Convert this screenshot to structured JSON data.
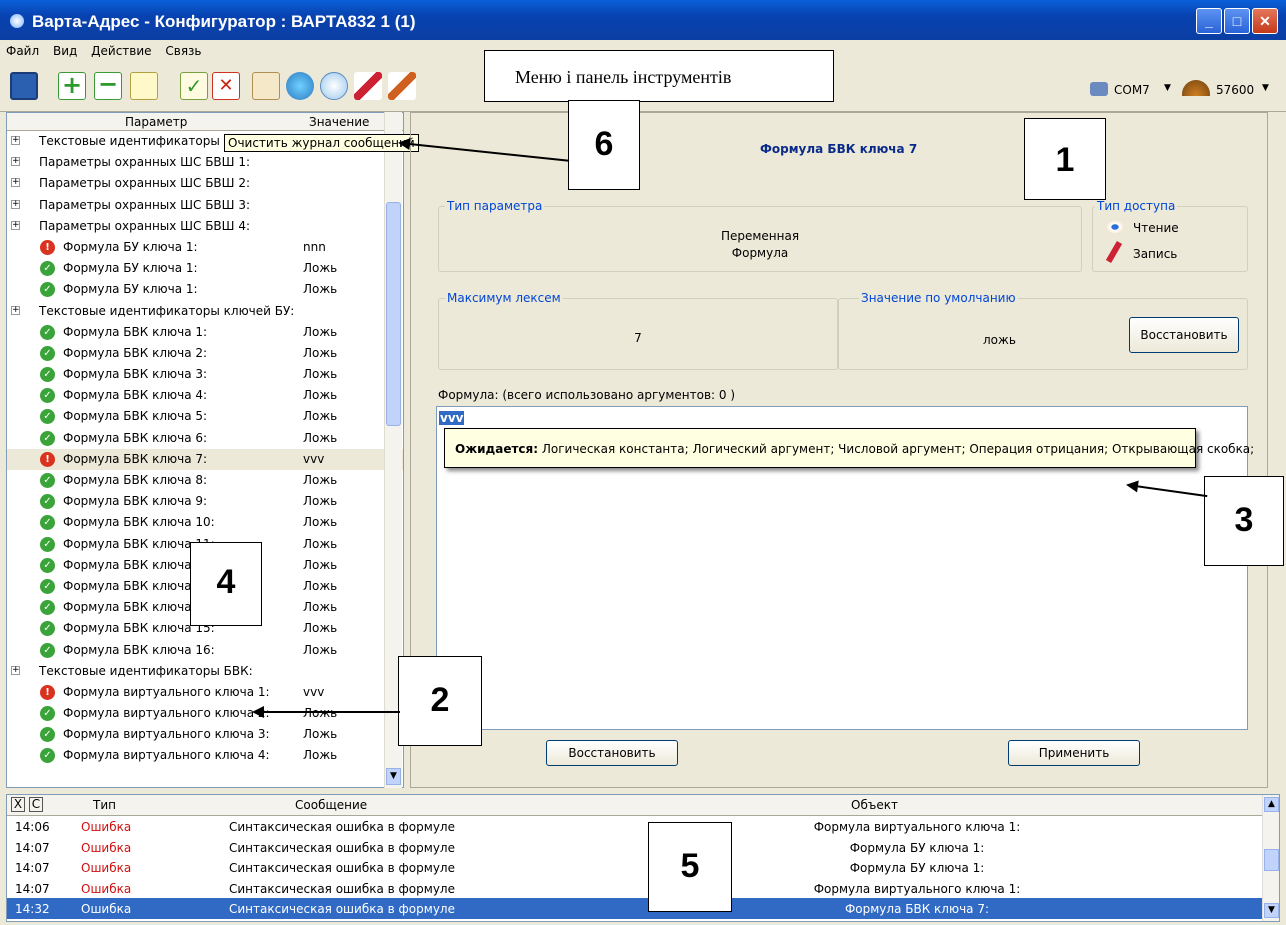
{
  "window": {
    "title": "Варта-Адрес - Конфигуратор : ВАРТА832 1 (1)",
    "min_icon": "minimize-icon",
    "max_icon": "maximize-icon",
    "close_icon": "close-icon"
  },
  "menu": [
    "Файл",
    "Вид",
    "Действие",
    "Связь"
  ],
  "toolbar": {
    "port": "COM7",
    "baud": "57600"
  },
  "callouts": {
    "menu_label": "Меню і панель інструментів",
    "c1": "1",
    "c2": "2",
    "c3": "3",
    "c4": "4",
    "c5": "5",
    "c6": "6"
  },
  "tree": {
    "col_param": "Параметр",
    "col_value": "Значение",
    "tooltip": "Очистить журнал сообщений",
    "rows": [
      {
        "type": "group",
        "label": "Текстовые идентификаторы Ш",
        "value": ""
      },
      {
        "type": "group",
        "label": "Параметры охранных ШС БВШ 1:",
        "value": ""
      },
      {
        "type": "group",
        "label": "Параметры охранных ШС БВШ 2:",
        "value": ""
      },
      {
        "type": "group",
        "label": "Параметры охранных ШС БВШ 3:",
        "value": ""
      },
      {
        "type": "group",
        "label": "Параметры охранных ШС БВШ 4:",
        "value": ""
      },
      {
        "type": "err",
        "label": "Формула БУ ключа 1:",
        "value": "nnn"
      },
      {
        "type": "ok",
        "label": "Формула БУ ключа 1:",
        "value": "Ложь"
      },
      {
        "type": "ok",
        "label": "Формула БУ ключа 1:",
        "value": "Ложь"
      },
      {
        "type": "group",
        "label": "Текстовые идентификаторы ключей БУ:",
        "value": ""
      },
      {
        "type": "ok",
        "label": "Формула БВК ключа 1:",
        "value": "Ложь"
      },
      {
        "type": "ok",
        "label": "Формула БВК ключа 2:",
        "value": "Ложь"
      },
      {
        "type": "ok",
        "label": "Формула БВК ключа 3:",
        "value": "Ложь"
      },
      {
        "type": "ok",
        "label": "Формула БВК ключа 4:",
        "value": "Ложь"
      },
      {
        "type": "ok",
        "label": "Формула БВК ключа 5:",
        "value": "Ложь"
      },
      {
        "type": "ok",
        "label": "Формула БВК ключа 6:",
        "value": "Ложь"
      },
      {
        "type": "err",
        "label": "Формула БВК ключа 7:",
        "value": "vvv",
        "selected": true
      },
      {
        "type": "ok",
        "label": "Формула БВК ключа 8:",
        "value": "Ложь"
      },
      {
        "type": "ok",
        "label": "Формула БВК ключа 9:",
        "value": "Ложь"
      },
      {
        "type": "ok",
        "label": "Формула БВК ключа 10:",
        "value": "Ложь"
      },
      {
        "type": "ok",
        "label": "Формула БВК ключа 11:",
        "value": "Ложь"
      },
      {
        "type": "ok",
        "label": "Формула БВК ключа 12:",
        "value": "Ложь"
      },
      {
        "type": "ok",
        "label": "Формула БВК ключа 13:",
        "value": "Ложь"
      },
      {
        "type": "ok",
        "label": "Формула БВК ключа 14:",
        "value": "Ложь"
      },
      {
        "type": "ok",
        "label": "Формула БВК ключа 15:",
        "value": "Ложь"
      },
      {
        "type": "ok",
        "label": "Формула БВК ключа 16:",
        "value": "Ложь"
      },
      {
        "type": "group",
        "label": "Текстовые идентификаторы БВК:",
        "value": ""
      },
      {
        "type": "err",
        "label": "Формула виртуального ключа 1:",
        "value": "vvv"
      },
      {
        "type": "ok",
        "label": "Формула виртуального ключа 2:",
        "value": "Ложь"
      },
      {
        "type": "ok",
        "label": "Формула виртуального ключа 3:",
        "value": "Ложь"
      },
      {
        "type": "ok",
        "label": "Формула виртуального ключа 4:",
        "value": "Ложь"
      }
    ]
  },
  "detail": {
    "heading": "Формула БВК ключа 7",
    "type_legend": "Тип параметра",
    "type_line1": "Переменная",
    "type_line2": "Формула",
    "access_legend": "Тип доступа",
    "access_read": "Чтение",
    "access_write": "Запись",
    "max_legend": "Максимум лексем",
    "max_value": "7",
    "default_legend": "Значение по умолчанию",
    "default_value": "ложь",
    "restore_top": "Восстановить",
    "formula_label": "Формула: (всего использовано аргументов: 0 )",
    "formula_text": "vvv",
    "tooltip_bold": "Ожидается:",
    "tooltip_text": " Логическая константа; Логический аргумент; Числовой аргумент; Операция отрицания; Открывающая скобка;",
    "restore_bottom": "Восстановить",
    "apply": "Применить"
  },
  "log": {
    "col_x": "X",
    "col_c": "C",
    "col_type": "Тип",
    "col_msg": "Сообщение",
    "col_obj": "Объект",
    "rows": [
      {
        "time": "14:06",
        "type": "Ошибка",
        "msg": "Синтаксическая ошибка в формуле",
        "obj": "Формула виртуального ключа 1:"
      },
      {
        "time": "14:07",
        "type": "Ошибка",
        "msg": "Синтаксическая ошибка в формуле",
        "obj": "Формула БУ ключа 1:"
      },
      {
        "time": "14:07",
        "type": "Ошибка",
        "msg": "Синтаксическая ошибка в формуле",
        "obj": "Формула БУ ключа 1:"
      },
      {
        "time": "14:07",
        "type": "Ошибка",
        "msg": "Синтаксическая ошибка в формуле",
        "obj": "Формула виртуального ключа 1:"
      },
      {
        "time": "14:32",
        "type": "Ошибка",
        "msg": "Синтаксическая ошибка в формуле",
        "obj": "Формула БВК ключа 7:",
        "selected": true
      }
    ]
  }
}
